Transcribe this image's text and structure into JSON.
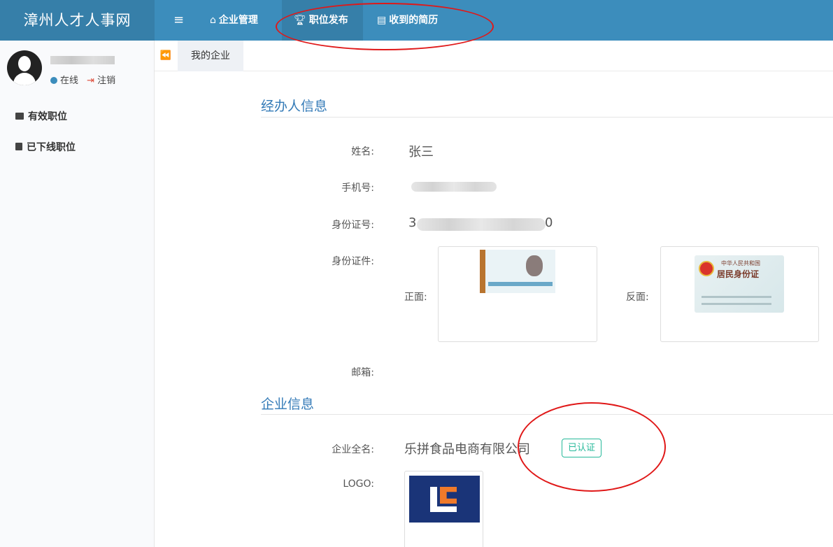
{
  "app": {
    "title": "漳州人才人事网"
  },
  "nav": {
    "menu_icon": "≡",
    "items": [
      {
        "label": "企业管理",
        "icon": "home-icon"
      },
      {
        "label": "职位发布",
        "icon": "trophy-icon"
      },
      {
        "label": "收到的简历",
        "icon": "id-card-icon"
      }
    ]
  },
  "sidebar": {
    "status_online": "在线",
    "logout": "注销",
    "items": [
      {
        "label": "有效职位",
        "icon": "briefcase-icon"
      },
      {
        "label": "已下线职位",
        "icon": "suitcase-icon"
      }
    ]
  },
  "tabs": {
    "back_icon": "⏪",
    "items": [
      {
        "label": "我的企业"
      }
    ]
  },
  "agent_section": {
    "title": "经办人信息",
    "name_label": "姓名:",
    "name_value": "张三",
    "phone_label": "手机号:",
    "id_label": "身份证号:",
    "id_prefix": "3",
    "id_suffix": "0",
    "id_doc_label": "身份证件:",
    "front_label": "正面:",
    "back_label": "反面:",
    "email_label": "邮箱:",
    "id_back_text1": "中华人民共和国",
    "id_back_text2": "居民身份证"
  },
  "company_section": {
    "title": "企业信息",
    "name_label": "企业全名:",
    "name_value": "乐拼食品电商有限公司",
    "verified_badge": "已认证",
    "logo_label": "LOGO:"
  },
  "colors": {
    "header": "#3c8dbc",
    "header_dark": "#367fa9",
    "accent": "#337ab7",
    "verified": "#26b99a",
    "annotation": "#e01818"
  }
}
